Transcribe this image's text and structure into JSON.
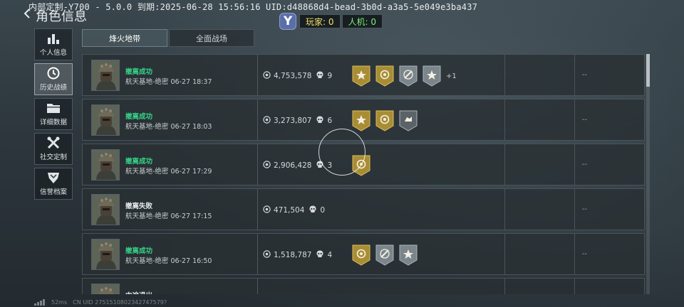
{
  "overlay": {
    "text": "内部定制-Y700 - 5.0.0  到期:2025-06-28 15:56:16 UID:d48868d4-bead-3b0d-a3a5-5e049e3ba437"
  },
  "header": {
    "title": "角色信息"
  },
  "counter": {
    "logo": "Y",
    "players": "玩家: 0",
    "bots": "人机: 0"
  },
  "sidebar": {
    "items": [
      {
        "label": "个人信息",
        "icon": "bar-chart-icon"
      },
      {
        "label": "历史战绩",
        "icon": "history-clock-icon"
      },
      {
        "label": "详细数据",
        "icon": "folder-icon"
      },
      {
        "label": "社交定制",
        "icon": "tools-icon"
      },
      {
        "label": "信誉档案",
        "icon": "shield-icon"
      }
    ]
  },
  "tabs": [
    {
      "label": "烽火地带"
    },
    {
      "label": "全面战场"
    }
  ],
  "records": [
    {
      "status": "撤离成功",
      "desc": "航天基地-绝密 06-27 18:37",
      "value": "4,753,578",
      "kills": "9",
      "badges": [
        "gold-star-badge",
        "gold-target-badge",
        "silver-wrench-badge",
        "silver-star-badge"
      ],
      "more": "+1",
      "tail": "--"
    },
    {
      "status": "撤离成功",
      "desc": "航天基地-绝密 06-27 18:03",
      "value": "3,273,807",
      "kills": "6",
      "badges": [
        "gold-star-badge",
        "gold-target-badge",
        "gray-hand-badge"
      ],
      "more": "",
      "tail": "--"
    },
    {
      "status": "撤离成功",
      "desc": "航天基地-绝密 06-27 17:29",
      "value": "2,906,428",
      "kills": "3",
      "badges": [
        "gold-target-badge"
      ],
      "more": "",
      "tail": "--"
    },
    {
      "status": "撤离失败",
      "desc": "航天基地-绝密 06-27 17:15",
      "value": "471,504",
      "kills": "0",
      "badges": [],
      "more": "",
      "tail": "--"
    },
    {
      "status": "撤离成功",
      "desc": "航天基地-绝密 06-27 16:50",
      "value": "1,518,787",
      "kills": "4",
      "badges": [
        "gold-target-badge",
        "silver-wrench-badge",
        "silver-star-badge"
      ],
      "more": "",
      "tail": "--"
    },
    {
      "status": "中途退出",
      "desc": "",
      "value": "",
      "kills": "",
      "badges": [],
      "more": "",
      "tail": ""
    }
  ],
  "bottom": {
    "ping": "52ms",
    "cn_uid": "CN UID 2751510802342747579?"
  },
  "colors": {
    "success": "#36d48a",
    "gold_badge": "#b89a3a",
    "silver_badge": "#7f8a90",
    "accent_yellow": "#f2e36a",
    "accent_green": "#7cf07a"
  }
}
